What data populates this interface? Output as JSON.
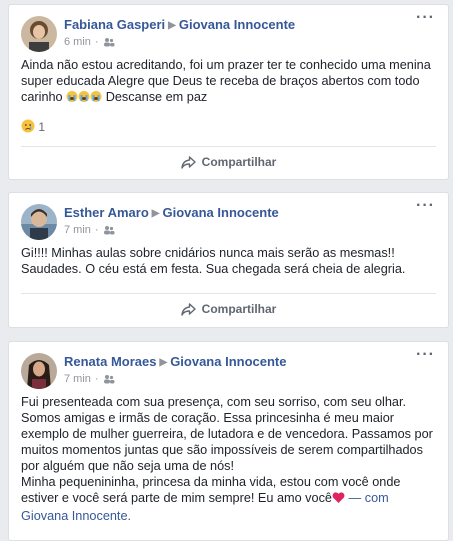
{
  "posts": [
    {
      "author": "Fabiana Gasperi",
      "target": "Giovana Innocente",
      "time": "6 min",
      "text": "Ainda não estou acreditando, foi um prazer ter te conhecido uma menina super educada Alegre que Deus te receba de braços abertos com todo carinho",
      "text_tail": "Descanse em paz",
      "reaction_count": "1",
      "share_label": "Compartilhar"
    },
    {
      "author": "Esther Amaro",
      "target": "Giovana Innocente",
      "time": "7 min",
      "text": "Gi!!!! Minhas aulas sobre cnidários nunca mais serão as mesmas!! Saudades. O céu está em festa. Sua chegada será cheia de alegria.",
      "share_label": "Compartilhar"
    },
    {
      "author": "Renata Moraes",
      "target": "Giovana Innocente",
      "time": "7 min",
      "text": "Fui presenteada com sua presença, com seu sorriso, com seu olhar. Somos amigas e irmãs de coração. Essa princesinha é meu maior exemplo de mulher guerreira, de lutadora e de vencedora. Passamos por muitos momentos juntas que são impossíveis de serem compartilhados por alguém que não seja uma de nós!",
      "text2": "Minha pequenininha, princesa da minha vida, estou com você onde estiver e você será parte de mim sempre! Eu amo você",
      "with_prefix": "— com",
      "with_name": "Giovana Innocente."
    }
  ],
  "colors": {
    "link": "#365899",
    "background": "#e9ebee",
    "heart": "#e0245e"
  },
  "icons": [
    "audience-friends-icon",
    "more-options-icon",
    "share-icon",
    "sad-reaction-icon",
    "crying-emoji-icon",
    "heart-emoji-icon"
  ]
}
